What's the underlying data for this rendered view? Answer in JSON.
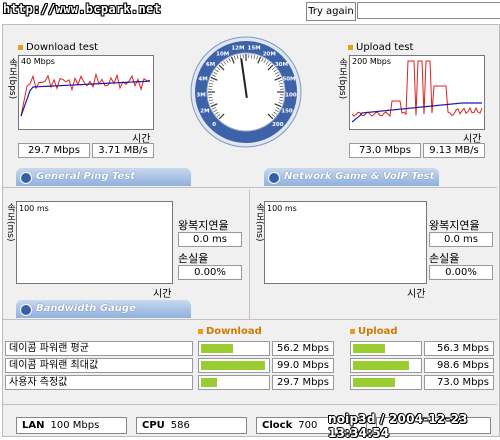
{
  "top": {
    "url": "http://www.bcpark.net",
    "try_again_label": "Try again",
    "input_value": ""
  },
  "download": {
    "title": "Download test",
    "ylabel": "속도(bps)",
    "max_label": "40 Mbps",
    "xlabel": "시간",
    "mbps": "29.7 Mbps",
    "mbs": "3.71 MB/s"
  },
  "upload": {
    "title": "Upload test",
    "ylabel": "속도(bps)",
    "max_label": "200 Mbps",
    "xlabel": "시간",
    "mbps": "73.0 Mbps",
    "mbs": "9.13 MB/s"
  },
  "gauge": {
    "ticks": [
      "0",
      "2M",
      "3M",
      "4M",
      "6M",
      "10M",
      "12M",
      "15M",
      "20M",
      "30M",
      "50M",
      "100",
      "150",
      "200"
    ],
    "needle_fraction": 0.47
  },
  "ping": {
    "tab_label": "General Ping Test",
    "ylabel": "속도(ms)",
    "max_label": "100 ms",
    "xlabel": "시간",
    "rtt_label": "왕복지연율",
    "rtt_value": "0.0 ms",
    "loss_label": "손실율",
    "loss_value": "0.00%"
  },
  "game": {
    "tab_label": "Network Game & VoIP Test",
    "ylabel": "속도(ms)",
    "max_label": "100 ms",
    "xlabel": "시간",
    "rtt_label": "왕복지연율",
    "rtt_value": "0.0 ms",
    "loss_label": "손실율",
    "loss_value": "0.00%"
  },
  "bandwidth": {
    "tab_label": "Bandwidth Gauge",
    "download_header": "Download",
    "upload_header": "Upload",
    "rows": [
      {
        "label": "데이콤 파워랜 평균",
        "down": "56.2 Mbps",
        "up": "56.3 Mbps",
        "down_fill": 0.45,
        "up_fill": 0.45
      },
      {
        "label": "데이콤 파워랜 최대값",
        "down": "99.0 Mbps",
        "up": "98.6 Mbps",
        "down_fill": 0.92,
        "up_fill": 0.8
      },
      {
        "label": "사용자 측정값",
        "down": "29.7 Mbps",
        "up": "73.0 Mbps",
        "down_fill": 0.23,
        "up_fill": 0.6
      }
    ]
  },
  "status": {
    "lan_label": "LAN",
    "lan_value": "100 Mbps",
    "cpu_label": "CPU",
    "cpu_value": "586",
    "clock_label": "Clock",
    "clock_value": "700",
    "timestamp": "noip3d / 2004-12-23 13:34:54"
  },
  "colors": {
    "download_line": "#e02020",
    "avg_line": "#1a1aa0",
    "bar_fill": "#9acd32",
    "accent_orange": "#f09a1a"
  }
}
